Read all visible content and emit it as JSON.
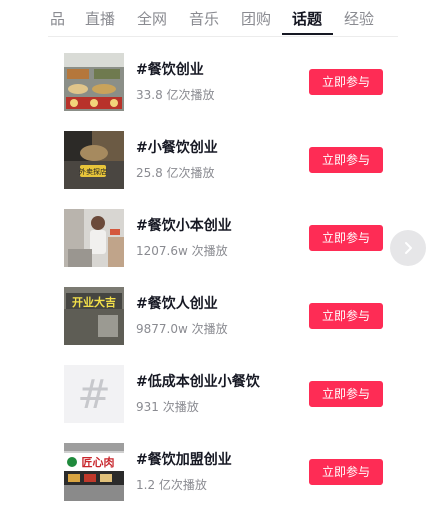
{
  "tabs": [
    {
      "label": "品"
    },
    {
      "label": "直播"
    },
    {
      "label": "全网"
    },
    {
      "label": "音乐"
    },
    {
      "label": "团购"
    },
    {
      "label": "话题",
      "active": true
    },
    {
      "label": "经验"
    }
  ],
  "topics": [
    {
      "title": "#餐饮创业",
      "plays": "33.8 亿次播放",
      "join_label": "立即参与"
    },
    {
      "title": "#小餐饮创业",
      "plays": "25.8 亿次播放",
      "join_label": "立即参与",
      "thumb_text": "外卖探店"
    },
    {
      "title": "#餐饮小本创业",
      "plays": "1207.6w 次播放",
      "join_label": "立即参与"
    },
    {
      "title": "#餐饮人创业",
      "plays": "9877.0w 次播放",
      "join_label": "立即参与",
      "thumb_text": "开业大吉"
    },
    {
      "title": "#低成本创业小餐饮",
      "plays": "931 次播放",
      "join_label": "立即参与",
      "thumb_text": "#"
    },
    {
      "title": "#餐饮加盟创业",
      "plays": "1.2 亿次播放",
      "join_label": "立即参与",
      "thumb_text": "匠心肉"
    }
  ],
  "colors": {
    "accent": "#fe2c55",
    "text": "#161823",
    "muted": "#8a8b91"
  },
  "icons": {
    "next": "chevron-right-icon",
    "placeholder": "hashtag-icon"
  }
}
